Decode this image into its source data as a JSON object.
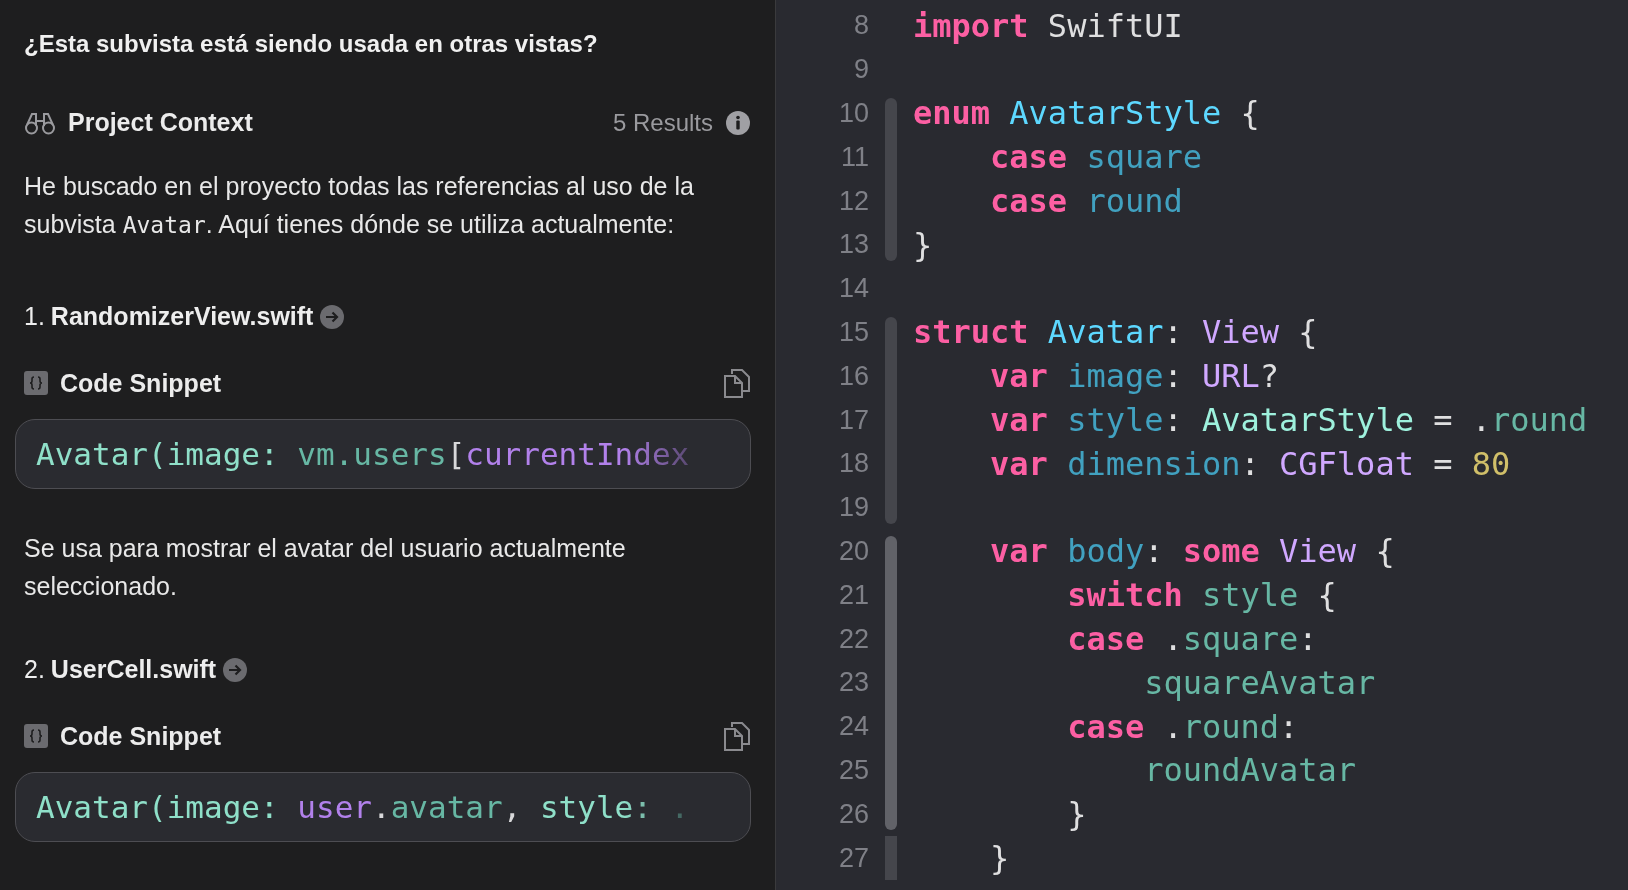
{
  "assistant": {
    "question": "¿Esta subvista está siendo usada en otras vistas?",
    "context": {
      "title": "Project Context",
      "results": "5 Results"
    },
    "intro": [
      {
        "text": "He buscado en el proyecto todas las referencias al uso de la subvista ",
        "kind": "plain"
      },
      {
        "text": "Avatar",
        "kind": "code"
      },
      {
        "text": ". Aquí tienes dónde se utiliza actualmente:",
        "kind": "plain"
      }
    ],
    "usages": [
      {
        "number": "1.",
        "file": "RandomizerView.swift",
        "snippet_label": "Code Snippet",
        "code": [
          {
            "text": "Avatar(",
            "kind": "call"
          },
          {
            "text": "image: ",
            "kind": "call"
          },
          {
            "text": "vm.users",
            "kind": "member"
          },
          {
            "text": "[",
            "kind": "plain"
          },
          {
            "text": "currentIndex",
            "kind": "local"
          }
        ],
        "description": "Se usa para mostrar el avatar del usuario actualmente seleccionado."
      },
      {
        "number": "2.",
        "file": "UserCell.swift",
        "snippet_label": "Code Snippet",
        "code": [
          {
            "text": "Avatar(",
            "kind": "call"
          },
          {
            "text": "image: ",
            "kind": "call"
          },
          {
            "text": "user",
            "kind": "local"
          },
          {
            "text": ".",
            "kind": "plain"
          },
          {
            "text": "avatar",
            "kind": "member"
          },
          {
            "text": ", ",
            "kind": "plain"
          },
          {
            "text": "style: ",
            "kind": "call"
          },
          {
            "text": ".",
            "kind": "member"
          }
        ]
      }
    ]
  },
  "editor": {
    "lines": [
      {
        "number": "8",
        "in_fold": false,
        "tokens": [
          {
            "text": "import",
            "kind": "keyword"
          },
          {
            "text": " SwiftUI",
            "kind": "plain"
          }
        ]
      },
      {
        "number": "9",
        "in_fold": false
      },
      {
        "number": "10",
        "in_fold": true,
        "fold_highlight": false,
        "tokens": [
          {
            "text": "enum",
            "kind": "keyword"
          },
          {
            "text": " AvatarStyle",
            "kind": "decl"
          },
          {
            "text": " {",
            "kind": "plain"
          }
        ]
      },
      {
        "number": "11",
        "in_fold": true,
        "fold_highlight": false,
        "tokens": [
          {
            "text": "    case",
            "kind": "keyword"
          },
          {
            "text": " square",
            "kind": "ident"
          }
        ]
      },
      {
        "number": "12",
        "in_fold": true,
        "fold_highlight": false,
        "tokens": [
          {
            "text": "    case",
            "kind": "keyword"
          },
          {
            "text": " round",
            "kind": "ident"
          }
        ]
      },
      {
        "number": "13",
        "in_fold": true,
        "fold_highlight": false,
        "tokens": [
          {
            "text": "}",
            "kind": "plain"
          }
        ]
      },
      {
        "number": "14",
        "in_fold": false
      },
      {
        "number": "15",
        "in_fold": true,
        "fold_highlight": false,
        "tokens": [
          {
            "text": "struct",
            "kind": "keyword"
          },
          {
            "text": " Avatar",
            "kind": "decl"
          },
          {
            "text": ": ",
            "kind": "plain"
          },
          {
            "text": "View",
            "kind": "type"
          },
          {
            "text": " {",
            "kind": "plain"
          }
        ]
      },
      {
        "number": "16",
        "in_fold": true,
        "fold_highlight": false,
        "tokens": [
          {
            "text": "    var",
            "kind": "keyword"
          },
          {
            "text": " image",
            "kind": "ident"
          },
          {
            "text": ": ",
            "kind": "plain"
          },
          {
            "text": "URL",
            "kind": "type"
          },
          {
            "text": "?",
            "kind": "plain"
          }
        ]
      },
      {
        "number": "17",
        "in_fold": true,
        "fold_highlight": false,
        "tokens": [
          {
            "text": "    var",
            "kind": "keyword"
          },
          {
            "text": " style",
            "kind": "ident"
          },
          {
            "text": ": ",
            "kind": "plain"
          },
          {
            "text": "AvatarStyle",
            "kind": "project"
          },
          {
            "text": " = .",
            "kind": "plain"
          },
          {
            "text": "round",
            "kind": "member"
          }
        ]
      },
      {
        "number": "18",
        "in_fold": true,
        "fold_highlight": false,
        "tokens": [
          {
            "text": "    var",
            "kind": "keyword"
          },
          {
            "text": " dimension",
            "kind": "ident"
          },
          {
            "text": ": ",
            "kind": "plain"
          },
          {
            "text": "CGFloat",
            "kind": "type"
          },
          {
            "text": " = ",
            "kind": "plain"
          },
          {
            "text": "80",
            "kind": "number"
          }
        ]
      },
      {
        "number": "19",
        "in_fold": true,
        "fold_highlight": false
      },
      {
        "number": "20",
        "in_fold": true,
        "fold_highlight": true,
        "tokens": [
          {
            "text": "    var",
            "kind": "keyword"
          },
          {
            "text": " body",
            "kind": "ident"
          },
          {
            "text": ": ",
            "kind": "plain"
          },
          {
            "text": "some",
            "kind": "keyword"
          },
          {
            "text": " View",
            "kind": "type"
          },
          {
            "text": " {",
            "kind": "plain"
          }
        ]
      },
      {
        "number": "21",
        "in_fold": true,
        "fold_highlight": true,
        "tokens": [
          {
            "text": "        switch",
            "kind": "keyword"
          },
          {
            "text": " style",
            "kind": "member"
          },
          {
            "text": " {",
            "kind": "plain"
          }
        ]
      },
      {
        "number": "22",
        "in_fold": true,
        "fold_highlight": true,
        "tokens": [
          {
            "text": "        case",
            "kind": "keyword"
          },
          {
            "text": " .",
            "kind": "plain"
          },
          {
            "text": "square",
            "kind": "member"
          },
          {
            "text": ":",
            "kind": "plain"
          }
        ]
      },
      {
        "number": "23",
        "in_fold": true,
        "fold_highlight": true,
        "tokens": [
          {
            "text": "            squareAvatar",
            "kind": "member"
          }
        ]
      },
      {
        "number": "24",
        "in_fold": true,
        "fold_highlight": true,
        "tokens": [
          {
            "text": "        case",
            "kind": "keyword"
          },
          {
            "text": " .",
            "kind": "plain"
          },
          {
            "text": "round",
            "kind": "member"
          },
          {
            "text": ":",
            "kind": "plain"
          }
        ]
      },
      {
        "number": "25",
        "in_fold": true,
        "fold_highlight": true,
        "tokens": [
          {
            "text": "            roundAvatar",
            "kind": "member"
          }
        ]
      },
      {
        "number": "26",
        "in_fold": true,
        "fold_highlight": true,
        "tokens": [
          {
            "text": "        }",
            "kind": "plain"
          }
        ]
      },
      {
        "number": "27",
        "in_fold": true,
        "fold_highlight": false,
        "tokens": [
          {
            "text": "    }",
            "kind": "plain"
          }
        ]
      }
    ]
  }
}
